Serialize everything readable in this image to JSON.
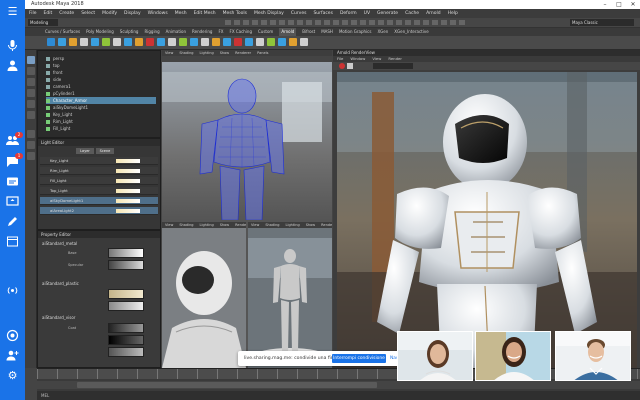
{
  "window": {
    "title": "Autodesk Maya 2018"
  },
  "menubar": [
    "File",
    "Edit",
    "Create",
    "Select",
    "Modify",
    "Display",
    "Windows",
    "Mesh",
    "Edit Mesh",
    "Mesh Tools",
    "Mesh Display",
    "Curves",
    "Surfaces",
    "Deform",
    "UV",
    "Generate",
    "Cache",
    "Arnold",
    "Help"
  ],
  "status": {
    "menuset": "Modeling",
    "workspace": "Maya Classic"
  },
  "shelf_tabs": [
    "Curves / Surfaces",
    "Poly Modeling",
    "Sculpting",
    "Rigging",
    "Animation",
    "Rendering",
    "FX",
    "FX Caching",
    "Custom",
    "Arnold",
    "Bifrost",
    "MASH",
    "Motion Graphics",
    "XGen",
    "XGen_Interactive"
  ],
  "outliner": {
    "items": [
      {
        "label": "persp",
        "selected": false
      },
      {
        "label": "top",
        "selected": false
      },
      {
        "label": "front",
        "selected": false
      },
      {
        "label": "side",
        "selected": false
      },
      {
        "label": "camera1",
        "selected": false
      },
      {
        "label": "pCylinder1",
        "selected": false
      },
      {
        "label": "Character_Armor",
        "selected": true
      },
      {
        "label": "aiSkyDomeLight1",
        "selected": false
      },
      {
        "label": "Key_Light",
        "selected": false
      },
      {
        "label": "Rim_Light",
        "selected": false
      },
      {
        "label": "Fill_Light",
        "selected": false
      }
    ]
  },
  "light_editor": {
    "title": "Light Editor",
    "buttons": [
      "Layer",
      "Scene"
    ],
    "rows": [
      "Key_Light",
      "Rim_Light",
      "Fill_Light",
      "Top_Light",
      "aiSkyDomeLight1",
      "aiAreaLight2"
    ]
  },
  "property_editor": {
    "title": "Property Editor",
    "groups": [
      "aiStandard_metal",
      "aiStandard_plastic",
      "aiStandard_visor"
    ],
    "labels": [
      "Base",
      "Specular",
      "Coat"
    ]
  },
  "viewports": {
    "top_label": "persp",
    "menu": [
      "View",
      "Shading",
      "Lighting",
      "Show",
      "Renderer",
      "Panels"
    ],
    "bottom_left_label": "persp",
    "bottom_right_label": "persp"
  },
  "render_view": {
    "title": "Arnold RenderView",
    "menu": [
      "File",
      "Window",
      "View",
      "Render"
    ]
  },
  "timeline": {
    "cmd_label": "MEL"
  },
  "share_banner": {
    "message": "live.sharing.mag.me: condivide una finestra.",
    "stop": "Interrompi condivisione",
    "hide": "Nascondi"
  },
  "meet_bar": {
    "icons": [
      "menu-icon",
      "mic-icon",
      "people-icon",
      "contacts-icon",
      "chat-icon",
      "captions-icon",
      "present-icon",
      "pen-icon",
      "calendar-icon",
      "broadcast-icon",
      "record-icon",
      "add-person-icon",
      "settings-icon"
    ],
    "badges": {
      "contacts": "2",
      "chat": "1"
    }
  },
  "colors": {
    "meet_blue": "#1a73e8",
    "maya_bg": "#444444",
    "selection": "#5285a6"
  }
}
